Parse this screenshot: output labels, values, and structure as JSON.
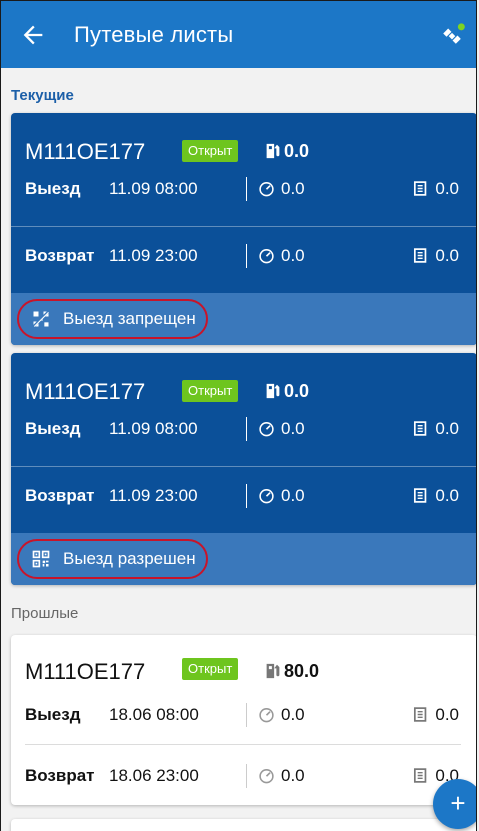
{
  "appbar": {
    "title": "Путевые листы"
  },
  "sections": {
    "current": "Текущие",
    "past": "Прошлые"
  },
  "cards": [
    {
      "plate": "М111ОЕ177",
      "badge": "Открыт",
      "fuel": "0.0",
      "exit": {
        "label": "Выезд",
        "date": "11.09 08:00",
        "odometer": "0.0",
        "fuel": "0.0"
      },
      "return": {
        "label": "Возврат",
        "date": "11.09 23:00",
        "odometer": "0.0",
        "fuel": "0.0"
      },
      "status": "Выезд запрещен"
    },
    {
      "plate": "М111ОЕ177",
      "badge": "Открыт",
      "fuel": "0.0",
      "exit": {
        "label": "Выезд",
        "date": "11.09 08:00",
        "odometer": "0.0",
        "fuel": "0.0"
      },
      "return": {
        "label": "Возврат",
        "date": "11.09 23:00",
        "odometer": "0.0",
        "fuel": "0.0"
      },
      "status": "Выезд разрешен"
    },
    {
      "plate": "М111ОЕ177",
      "badge": "Открыт",
      "fuel": "80.0",
      "exit": {
        "label": "Выезд",
        "date": "18.06 08:00",
        "odometer": "0.0",
        "fuel": "0.0"
      },
      "return": {
        "label": "Возврат",
        "date": "18.06 23:00",
        "odometer": "0.0",
        "fuel": "0.0"
      }
    }
  ],
  "fab": "+",
  "colors": {
    "primary": "#1c77c7",
    "card": "#0b5099",
    "status_bar": "#3a78bb",
    "badge": "#6ec51e",
    "highlight": "#c8142a"
  }
}
